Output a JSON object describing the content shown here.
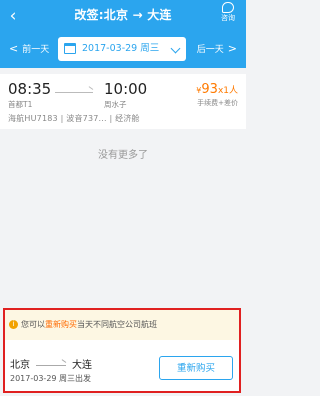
{
  "header": {
    "back_icon": "chevron-left-icon",
    "title_prefix": "改签:",
    "origin": "北京",
    "arrow": "→",
    "destination": "大连",
    "consult_label": "咨询"
  },
  "date_nav": {
    "prev_arrow": "<",
    "prev_label": "前一天",
    "date": "2017-03-29",
    "weekday": "周三",
    "next_label": "后一天",
    "next_arrow": ">"
  },
  "flight": {
    "dep_time": "08:35",
    "arr_time": "10:00",
    "dep_airport": "首都T1",
    "arr_airport": "周水子",
    "currency": "¥",
    "price": "93",
    "qty": "x1人",
    "fee_note": "手续费+差价",
    "airline_flight": "海航HU7183",
    "aircraft": "波音737...",
    "cabin": "经济舱",
    "sep": "|"
  },
  "list_end_text": "没有更多了",
  "rebuy": {
    "info_icon": "i",
    "notice_pre": "您可以",
    "notice_highlight": "重新购买",
    "notice_post": "当天不同航空公司航班",
    "origin": "北京",
    "destination": "大连",
    "date_text": "2017-03-29 周三出发",
    "button_label": "重新购买"
  },
  "colors": {
    "header_bg": "#2ba5ee",
    "accent_price": "#ff7a00",
    "highlight_box": "#e02020"
  }
}
